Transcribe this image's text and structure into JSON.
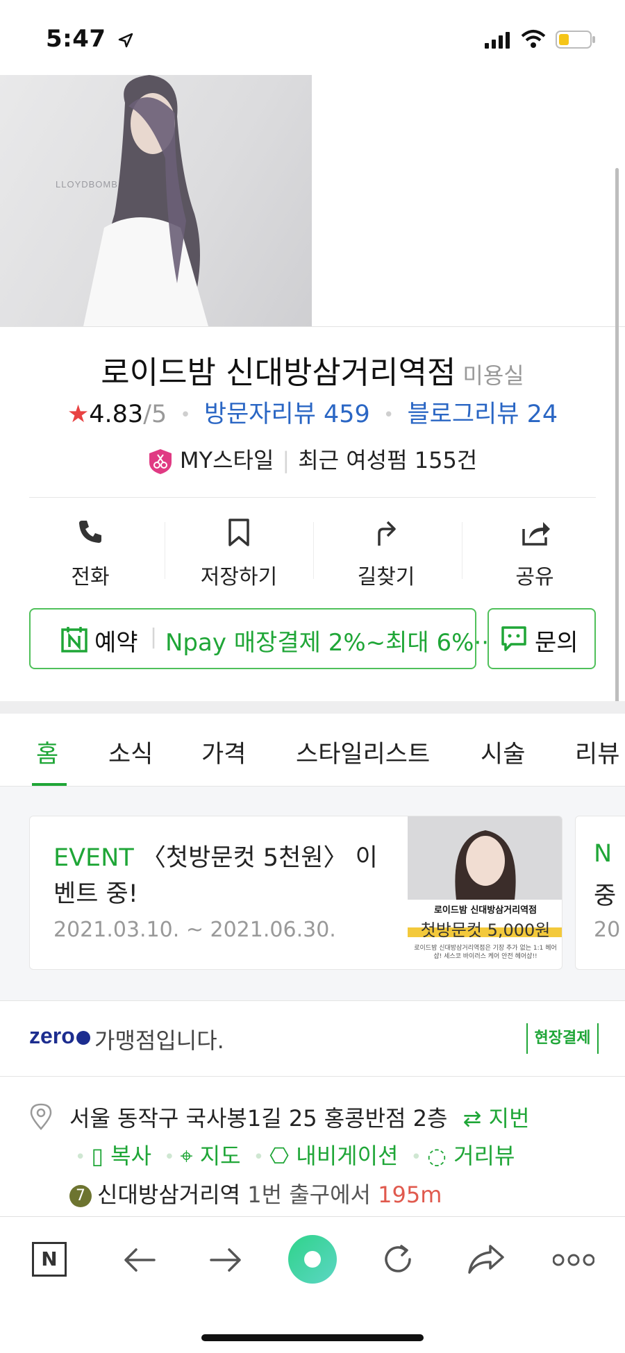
{
  "status_bar": {
    "time": "5:47"
  },
  "place": {
    "name": "로이드밤 신대방삼거리역점",
    "category": "미용실",
    "rating": "4.83",
    "rating_max": "/5",
    "visitor_reviews": "방문자리뷰 459",
    "blog_reviews": "블로그리뷰 24",
    "my_style": "MY스타일",
    "recent": "최근 여성펌 155건",
    "hero_watermark": "LLOYDBOMB"
  },
  "actions": [
    {
      "label": "전화",
      "icon": "phone-icon"
    },
    {
      "label": "저장하기",
      "icon": "bookmark-icon"
    },
    {
      "label": "길찾기",
      "icon": "directions-icon"
    },
    {
      "label": "공유",
      "icon": "share-icon"
    }
  ],
  "reserve": {
    "label": "예약",
    "npay": "Npay 매장결제 2%~최대 6%···",
    "inquiry": "문의"
  },
  "tabs": [
    "홈",
    "소식",
    "가격",
    "스타일리스트",
    "시술",
    "리뷰"
  ],
  "event": {
    "tag": "EVENT",
    "title": "〈첫방문컷 5천원〉 이벤트 중!",
    "date": "2021.03.10. ~ 2021.06.30.",
    "img_title": "로이드밤 신대방삼거리역점",
    "img_price": "첫방문컷 5,000원",
    "img_note": "로이드밤 신대방삼거리역점은 기장 추가 없는 1:1 헤어샵! 세스코 바이러스 케어 안전 헤어샵!!"
  },
  "event2": {
    "tag": "N",
    "text": "중",
    "date": "20"
  },
  "zeropay": {
    "logo": "zero",
    "text": "가맹점입니다.",
    "onsite": "현장결제"
  },
  "address": {
    "text": "서울 동작구 국사봉1길 25 홍콩반점 2층",
    "lot_label": "지번",
    "links": [
      "복사",
      "지도",
      "내비게이션",
      "거리뷰"
    ],
    "subway_line": "7",
    "subway_station": "신대방삼거리역",
    "subway_exit": "1번 출구에서",
    "subway_distance": "195m"
  },
  "toolbar": {
    "naver": "N",
    "icons": [
      "back-icon",
      "forward-icon",
      "green-dot-icon",
      "refresh-icon",
      "share-icon",
      "more-icon"
    ]
  },
  "colors": {
    "accent_green": "#1fa637",
    "link_blue": "#2a66c4",
    "star_red": "#e84242"
  }
}
